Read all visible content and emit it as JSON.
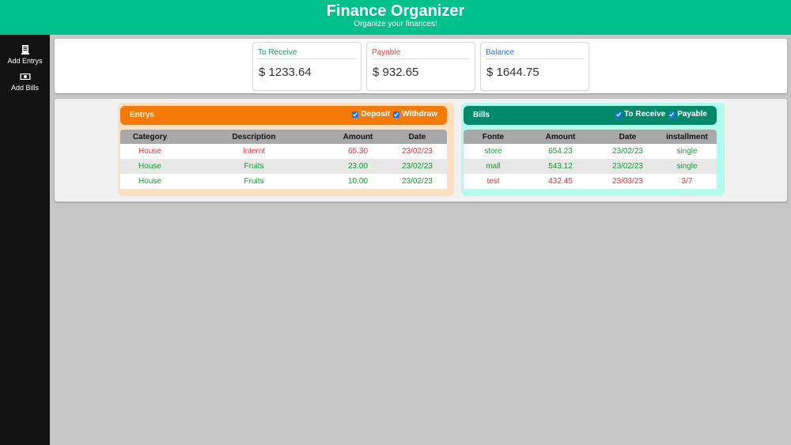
{
  "header": {
    "title": "Finance Organizer",
    "subtitle": "Organize your finances!"
  },
  "sidebar": {
    "items": [
      {
        "label": "Add Entrys",
        "icon": "receipt-icon"
      },
      {
        "label": "Add Bills",
        "icon": "money-bill-icon"
      }
    ]
  },
  "summary": {
    "to_receive": {
      "label": "To Receive",
      "value": "$ 1233.64"
    },
    "payable": {
      "label": "Payable",
      "value": "$ 932.65"
    },
    "balance": {
      "label": "Balance",
      "value": "$ 1644.75"
    }
  },
  "entrys": {
    "title": "Entrys",
    "filters": [
      {
        "label": "Deposit",
        "checked": true
      },
      {
        "label": "Withdraw",
        "checked": true
      }
    ],
    "columns": [
      "Category",
      "Description",
      "Amount",
      "Date"
    ],
    "rows": [
      {
        "status": "red",
        "cells": [
          "House",
          "Internt",
          "65.30",
          "23/02/23"
        ]
      },
      {
        "status": "green",
        "cells": [
          "House",
          "Fruits",
          "23.00",
          "23/02/23"
        ]
      },
      {
        "status": "green",
        "cells": [
          "House",
          "Fruits",
          "10.00",
          "23/02/23"
        ]
      }
    ]
  },
  "bills": {
    "title": "Bills",
    "filters": [
      {
        "label": "To Receive",
        "checked": true
      },
      {
        "label": "Payable",
        "checked": true
      }
    ],
    "columns": [
      "Fonte",
      "Amount",
      "Date",
      "installment"
    ],
    "rows": [
      {
        "status": "green",
        "cells": [
          "store",
          "654.23",
          "23/02/23",
          "single"
        ]
      },
      {
        "status": "green",
        "cells": [
          "mall",
          "543.12",
          "23/02/23",
          "single"
        ]
      },
      {
        "status": "red",
        "cells": [
          "test",
          "432.45",
          "23/03/23",
          "3/7"
        ]
      }
    ]
  },
  "colors": {
    "header": "#00c08b",
    "sidebar": "#121212",
    "entrys_accent": "#f57a08",
    "bills_accent": "#008a6a",
    "positive": "#149b30",
    "negative": "#e8323a"
  }
}
